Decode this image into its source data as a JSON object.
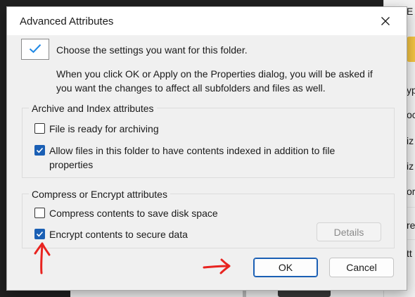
{
  "background": {
    "fragments": [
      "E",
      "yp",
      "oc",
      "iz",
      "iz",
      "or",
      "re",
      "tt"
    ]
  },
  "dialog": {
    "title": "Advanced Attributes",
    "heading": "Choose the settings you want for this folder.",
    "description": "When you click OK or Apply on the Properties dialog, you will be asked if you want the changes to affect all subfolders and files as well."
  },
  "archive_group": {
    "label": "Archive and Index attributes",
    "options": [
      {
        "label": "File is ready for archiving",
        "checked": false
      },
      {
        "label": "Allow files in this folder to have contents indexed in addition to file properties",
        "checked": true
      }
    ]
  },
  "compress_group": {
    "label": "Compress or Encrypt attributes",
    "options": [
      {
        "label": "Compress contents to save disk space",
        "checked": false
      },
      {
        "label": "Encrypt contents to secure data",
        "checked": true
      }
    ],
    "details_label": "Details"
  },
  "buttons": {
    "ok": "OK",
    "cancel": "Cancel"
  },
  "colors": {
    "accent": "#1a5fb4",
    "annotation": "#e8231f"
  },
  "icons": {
    "info": "checkmark-icon",
    "close": "close-icon",
    "annotation_up": "arrow-up-annotation-icon",
    "annotation_right": "arrow-right-annotation-icon"
  }
}
